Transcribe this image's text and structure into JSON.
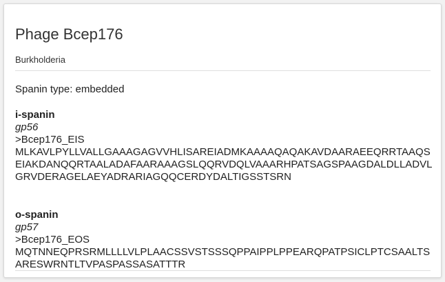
{
  "phage": {
    "title": "Phage Bcep176",
    "host": "Burkholderia",
    "spanin_type": "Spanin type: embedded"
  },
  "i_spanin": {
    "heading": "i-spanin",
    "gene": "gp56",
    "fasta_header": ">Bcep176_EIS",
    "sequence": "MLKAVLPYLLVALLGAAAGAGVVHLISAREIADMKAAAAQAQAKAVDAARAEEQRRTAAQSEIAKDANQQRTAALADAFAARAAAGSLQQRVDQLVAAARHPATSAGSPAAGDALDLLADVLGRVDERAGELAEYADRARIAGQQCERDYDALTIGSSTSRN"
  },
  "o_spanin": {
    "heading": "o-spanin",
    "gene": "gp57",
    "fasta_header": ">Bcep176_EOS",
    "sequence": "MQTNNEQPRSRMLLLLVLPLAACSSVSTSSSQPPAIPPLPPEARQPATPSICLPTCSAALTSARESWRNTLTVPASPASSASATTTR"
  }
}
